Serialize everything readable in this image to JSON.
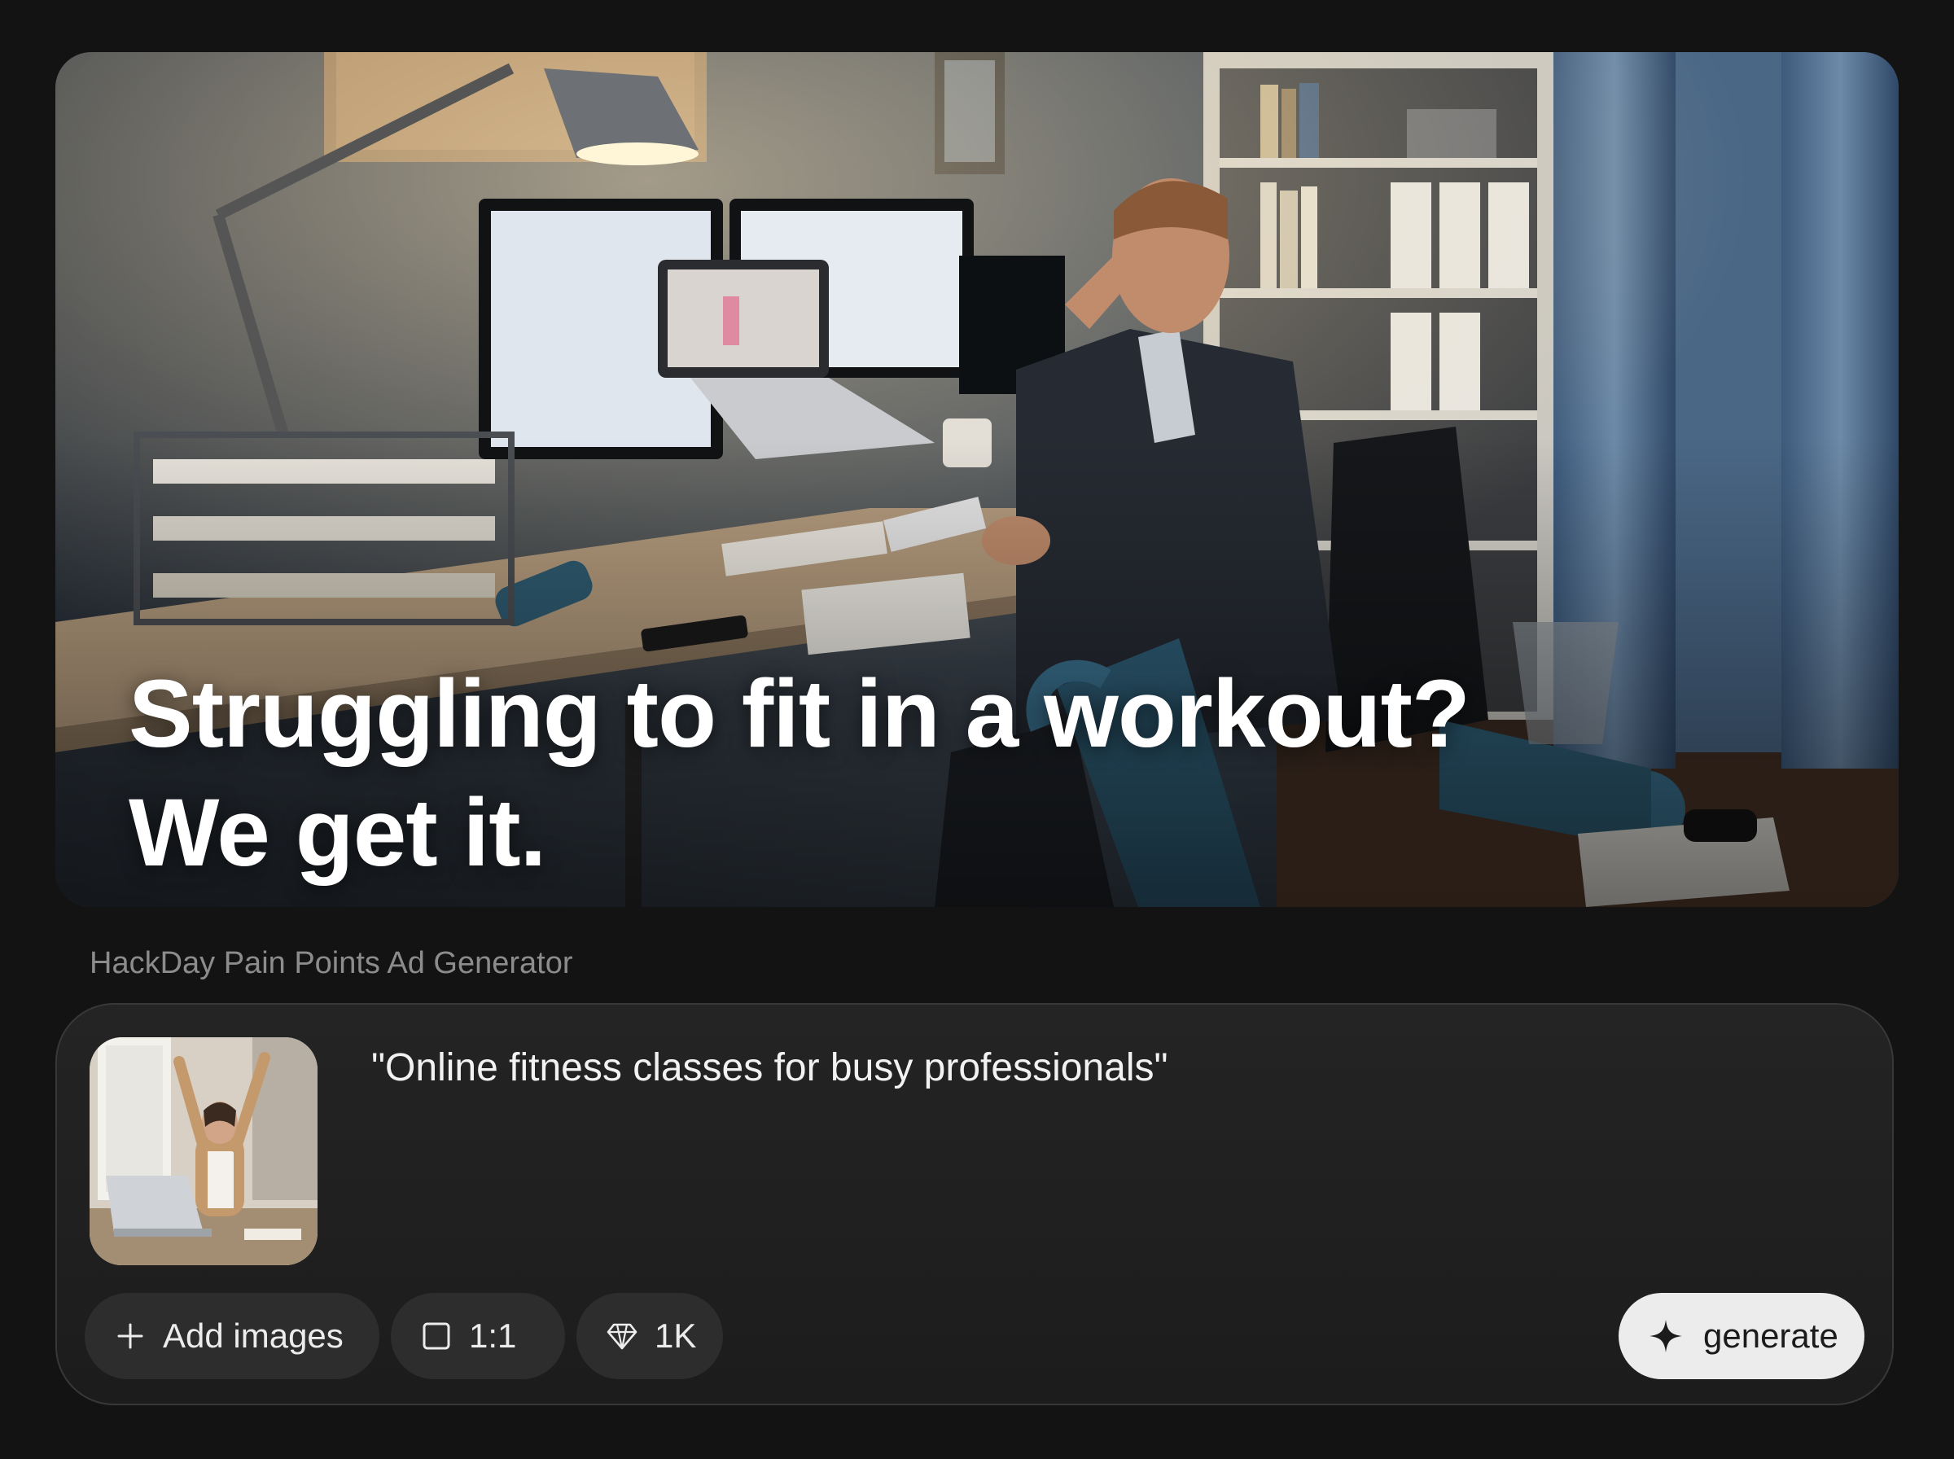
{
  "hero": {
    "headline_line1": "Struggling to fit in a workout?",
    "headline_line2": "We get it."
  },
  "app": {
    "label": "HackDay Pain Points Ad Generator"
  },
  "composer": {
    "prompt_text": "\"Online fitness classes for busy professionals\"",
    "add_images_label": "Add images",
    "aspect_ratio_label": "1:1",
    "resolution_label": "1K",
    "generate_label": "generate"
  },
  "icons": {
    "add": "plus-icon",
    "ratio": "square-icon",
    "resolution": "diamond-icon",
    "generate": "sparkle-icon"
  },
  "colors": {
    "background": "#131313",
    "composer": "#212121",
    "chip": "#2d2d2d",
    "generate_button": "#ececec",
    "label": "#8c8c8c"
  }
}
